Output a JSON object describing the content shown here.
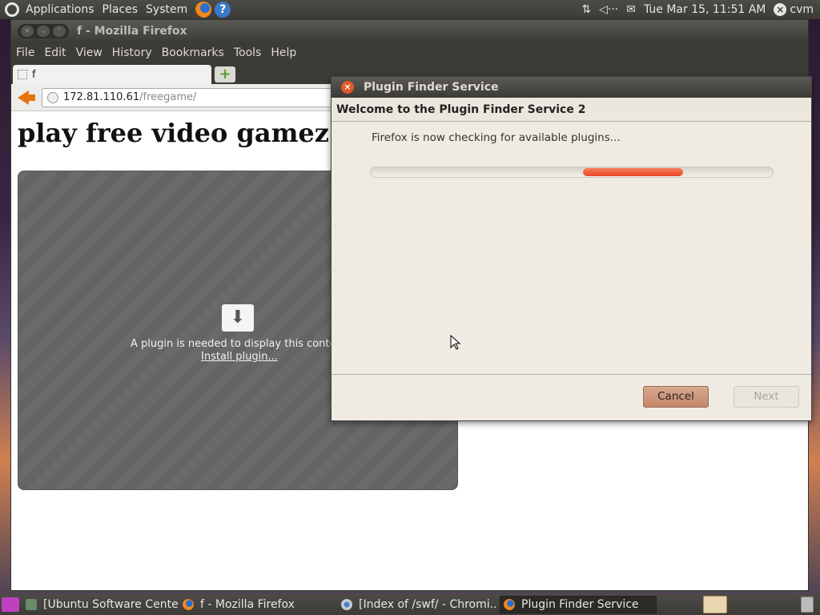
{
  "top_panel": {
    "menus": [
      "Applications",
      "Places",
      "System"
    ],
    "datetime": "Tue Mar 15, 11:51 AM",
    "username": "cvm"
  },
  "firefox": {
    "window_title": "f - Mozilla Firefox",
    "menu": [
      "File",
      "Edit",
      "View",
      "History",
      "Bookmarks",
      "Tools",
      "Help"
    ],
    "tab_title": "f",
    "url_host": "172.81.110.61",
    "url_path": "/freegame/",
    "page": {
      "heading": "play free video gamez",
      "plugin_message": "A plugin is needed to display this conter",
      "install_link": "Install plugin..."
    }
  },
  "dialog": {
    "title": "Plugin Finder Service",
    "header": "Welcome to the Plugin Finder Service 2",
    "status": "Firefox is now checking for available plugins...",
    "cancel_label": "Cancel",
    "next_label": "Next"
  },
  "taskbar": {
    "tasks": [
      "[Ubuntu Software Center]",
      "f - Mozilla Firefox",
      "[Index of /swf/ - Chromi...",
      "Plugin Finder Service"
    ]
  },
  "colors": {
    "panel": "#3c3b37",
    "dialog_bg": "#f0ebe2",
    "progress_fill": "#e8492a",
    "cancel_button": "#c4876a"
  }
}
